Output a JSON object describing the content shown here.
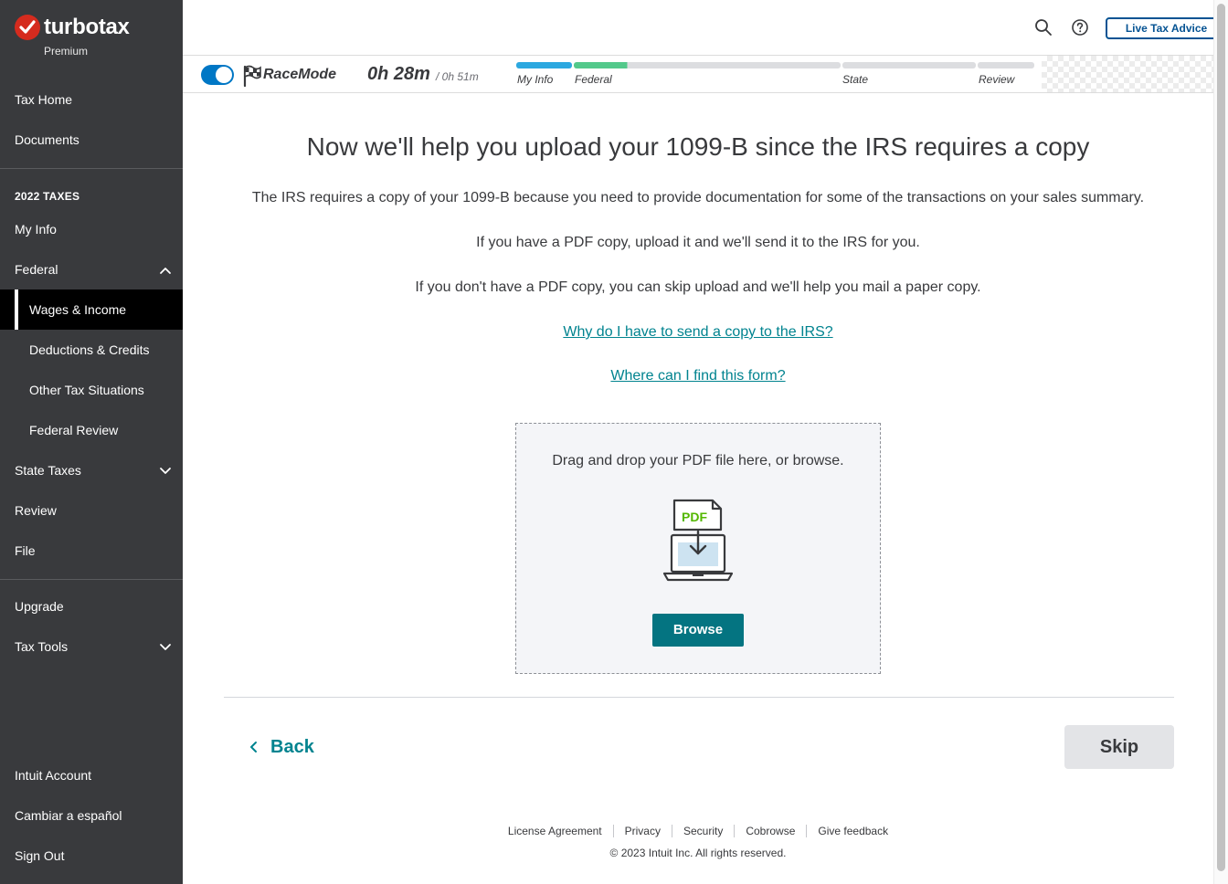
{
  "brand": {
    "name": "turbotax",
    "edition": "Premium",
    "check_color": "#d52b1e"
  },
  "sidebar": {
    "top_items": [
      {
        "label": "Tax Home"
      },
      {
        "label": "Documents"
      }
    ],
    "section_heading": "2022 TAXES",
    "tax_items": [
      {
        "label": "My Info"
      },
      {
        "label": "Federal",
        "expanded": true
      },
      {
        "label": "Wages & Income",
        "active": true
      },
      {
        "label": "Deductions & Credits"
      },
      {
        "label": "Other Tax Situations"
      },
      {
        "label": "Federal Review"
      },
      {
        "label": "State Taxes",
        "expanded": false
      },
      {
        "label": "Review"
      },
      {
        "label": "File"
      }
    ],
    "extra_items": [
      {
        "label": "Upgrade"
      },
      {
        "label": "Tax Tools",
        "expanded": false
      }
    ],
    "bottom_items": [
      {
        "label": "Intuit Account"
      },
      {
        "label": "Cambiar a español"
      },
      {
        "label": "Sign Out"
      }
    ]
  },
  "header": {
    "live_advice_label": "Live Tax Advice",
    "icons": [
      "search-icon",
      "help-icon"
    ]
  },
  "racebar": {
    "mode_label": "RaceMode",
    "toggle_on": true,
    "elapsed": "0h 28m",
    "target": "/ 0h 51m",
    "stages": [
      {
        "label": "My Info",
        "color": "#2ca8e0",
        "complete": true
      },
      {
        "label": "Federal",
        "color": "#53c98b",
        "progress": 0.2
      },
      {
        "label": "State",
        "color": "#dcdde0"
      },
      {
        "label": "Review",
        "color": "#dcdde0"
      }
    ]
  },
  "main": {
    "title": "Now we'll help you upload your 1099-B since the IRS requires a copy",
    "paragraphs": [
      "The IRS requires a copy of your 1099-B because you need to provide documentation for some of the transactions on your sales summary.",
      "If you have a PDF copy, upload it and we'll send it to the IRS for you.",
      "If you don't have a PDF copy, you can skip upload and we'll help you mail a paper copy."
    ],
    "links": [
      "Why do I have to send a copy to the IRS?",
      "Where can I find this form?"
    ],
    "dropzone": {
      "instruction": "Drag and drop your PDF file here, or browse.",
      "icon_label": "PDF",
      "browse_label": "Browse"
    },
    "back_label": "Back",
    "skip_label": "Skip"
  },
  "footer": {
    "links": [
      "License Agreement",
      "Privacy",
      "Security",
      "Cobrowse",
      "Give feedback"
    ],
    "copyright": "© 2023 Intuit Inc. All rights reserved."
  },
  "colors": {
    "sidebar_bg": "#393a3d",
    "accent_teal": "#047481",
    "link_teal": "#00838f",
    "live_advice_blue": "#055393",
    "toggle_blue": "#0077c5"
  }
}
